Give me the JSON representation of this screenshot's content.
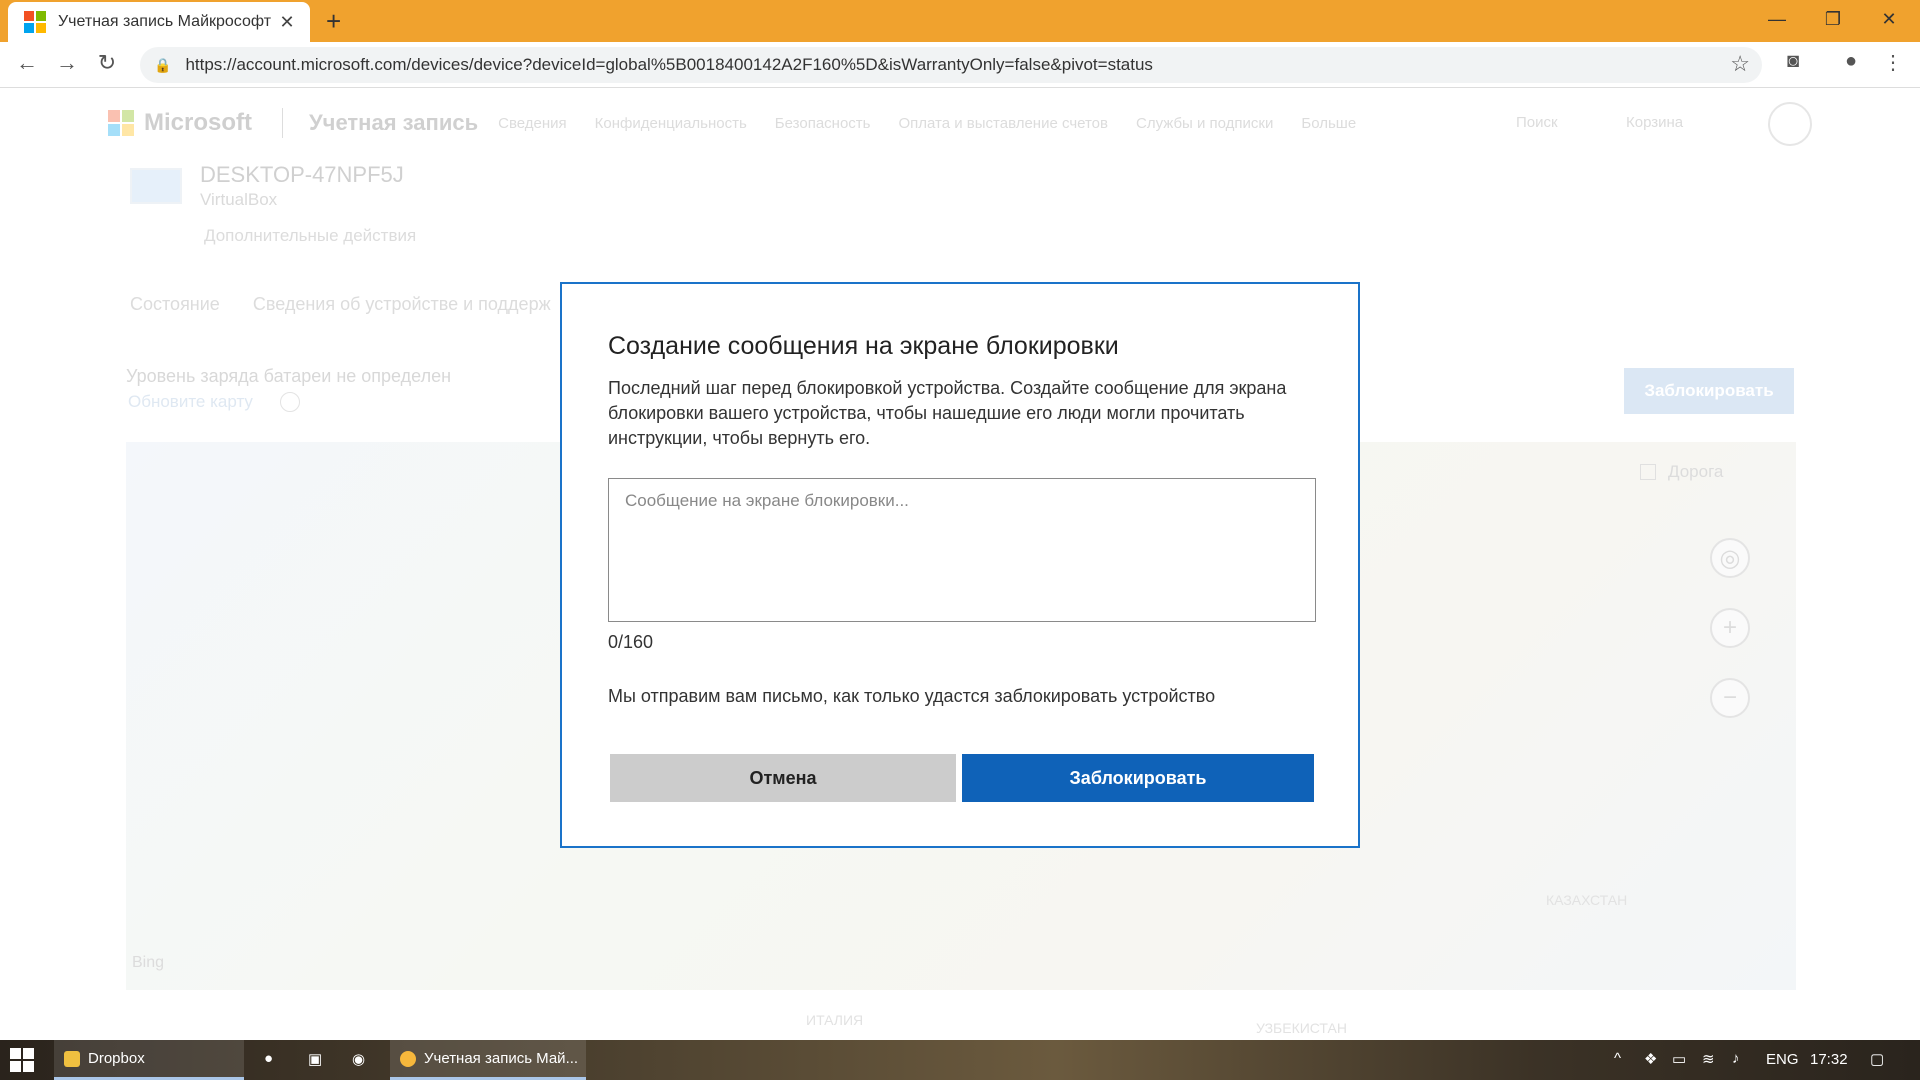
{
  "browser": {
    "tab_title": "Учетная запись Майкрософт | Р",
    "tab_close": "✕",
    "new_tab": "+",
    "url": "https://account.microsoft.com/devices/device?deviceId=global%5B0018400142A2F160%5D&isWarrantyOnly=false&pivot=status",
    "window_controls": {
      "minimize": "—",
      "maximize": "❐",
      "close": "✕"
    },
    "nav": {
      "back": "←",
      "forward": "→",
      "reload": "↻"
    }
  },
  "site_nav": {
    "brand": "Microsoft",
    "account": "Учетная запись",
    "links": [
      "Сведения",
      "Конфиденциальность",
      "Безопасность",
      "Оплата и выставление счетов",
      "Службы и подписки",
      "Больше"
    ],
    "search": "Поиск",
    "cart": "Корзина"
  },
  "device": {
    "name": "DESKTOP-47NPF5J",
    "model": "VirtualBox",
    "more_actions": "Дополнительные действия",
    "tabs": [
      "Состояние",
      "Сведения об устройстве и поддерж"
    ],
    "battery_status": "Уровень заряда батареи не определен",
    "update_map": "Обновите карту",
    "lock_button": "Заблокировать",
    "roads_label": "Дорога",
    "map_labels": [
      "КАЗАХСТАН",
      "ИТАЛИЯ",
      "УЗБЕКИСТАН"
    ],
    "bing": "Bing"
  },
  "modal": {
    "title": "Создание сообщения на экране блокировки",
    "description": "Последний шаг перед блокировкой устройства. Создайте сообщение для экрана блокировки вашего устройства, чтобы нашедшие его люди могли прочитать инструкции, чтобы вернуть его.",
    "message_placeholder": "Сообщение на экране блокировки...",
    "message_value": "",
    "counter": "0/160",
    "email_note": "Мы отправим вам письмо, как только удастся заблокировать устройство",
    "cancel_label": "Отмена",
    "lock_label": "Заблокировать",
    "lock_color": "#0f62b8",
    "border_color": "#1a73c9"
  },
  "taskbar": {
    "items": [
      "Dropbox",
      "Учетная запись Май..."
    ],
    "language": "ENG",
    "time": "17:32"
  }
}
